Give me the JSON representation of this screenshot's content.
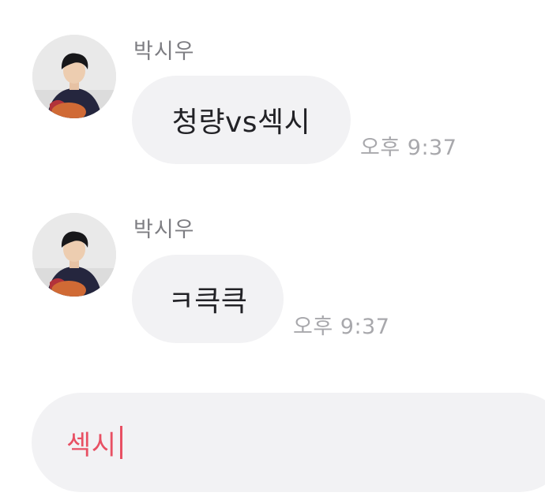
{
  "messages": [
    {
      "sender": "박시우",
      "text": "청량vs섹시",
      "time": "오후 9:37",
      "avatar_icon": "profile-photo-icon"
    },
    {
      "sender": "박시우",
      "text": "ㅋ큭큭",
      "time": "오후 9:37",
      "avatar_icon": "profile-photo-icon"
    }
  ],
  "composer": {
    "value": "섹시"
  },
  "colors": {
    "bubble": "#f2f2f4",
    "accent_text": "#e85063",
    "sender_text": "#7d7d82",
    "time_text": "#a8a8ac"
  }
}
